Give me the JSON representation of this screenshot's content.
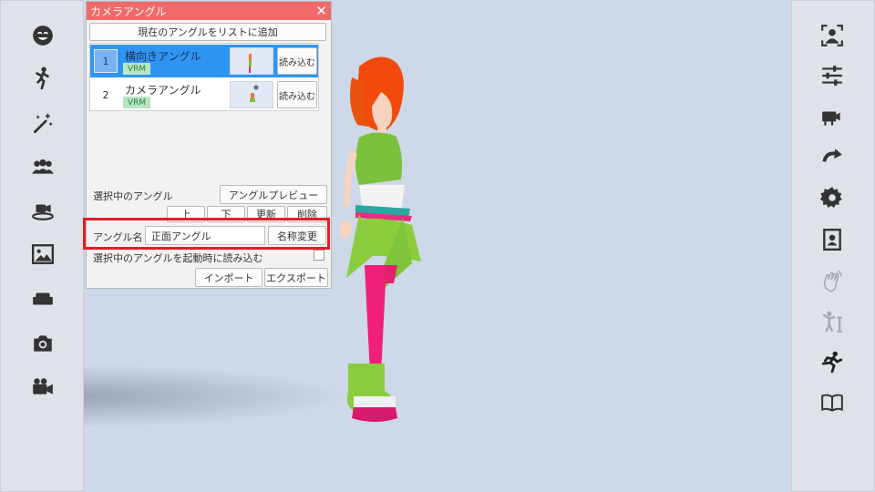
{
  "panel": {
    "title": "カメラアングル",
    "add_button": "現在のアングルをリストに追加",
    "items": [
      {
        "num": "1",
        "name": "横向きアングル",
        "badge": "VRM",
        "load": "読み込む"
      },
      {
        "num": "2",
        "name": "カメラアングル",
        "badge": "VRM",
        "load": "読み込む"
      }
    ],
    "selected_label": "選択中のアングル",
    "preview_button": "アングルプレビュー",
    "up_button": "上",
    "down_button": "下",
    "update_button": "更新",
    "delete_button": "削除",
    "name_label": "アングル名",
    "name_value": "正面アングル",
    "rename_button": "名称変更",
    "startup_label": "選択中のアングルを起動時に読み込む",
    "import_button": "インポート",
    "export_button": "エクスポート"
  },
  "left_sidebar": [
    "face-icon",
    "pose-icon",
    "magic-wand-icon",
    "group-icon",
    "camera-stage-icon",
    "image-icon",
    "sofa-icon",
    "camera-icon",
    "video-camera-icon"
  ],
  "right_sidebar": [
    "person-frame-icon",
    "sliders-icon",
    "video-swap-icon",
    "redo-icon",
    "gear-icon",
    "portrait-icon",
    "wave-hand-icon",
    "ik-pose-icon",
    "running-icon",
    "book-icon"
  ],
  "colors": {
    "title_bar": "#f06a6a",
    "selected": "#2f95f2",
    "highlight": "#e31e24",
    "background": "#cdd8e8"
  }
}
